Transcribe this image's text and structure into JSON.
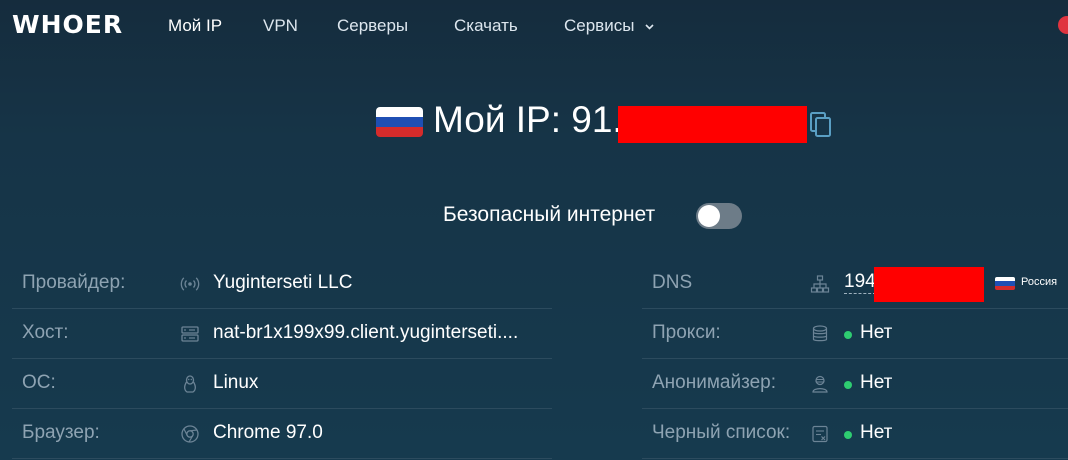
{
  "header": {
    "logo": "WHOER",
    "nav": [
      {
        "label": "Мой IP",
        "active": true
      },
      {
        "label": "VPN",
        "active": false
      },
      {
        "label": "Серверы",
        "active": false
      },
      {
        "label": "Скачать",
        "active": false
      },
      {
        "label": "Сервисы",
        "active": false,
        "has_dropdown": true
      }
    ]
  },
  "ip_section": {
    "country_flag": "russia-flag",
    "title": "Мой IP: 91.",
    "copy_icon": "copy-icon"
  },
  "safe_internet": {
    "label": "Безопасный интернет",
    "enabled": false
  },
  "left_rows": [
    {
      "label": "Провайдер:",
      "icon": "signal-icon",
      "value": "Yuginterseti LLC"
    },
    {
      "label": "Хост:",
      "icon": "server-icon",
      "value": "nat-br1x199x99.client.yuginterseti...."
    },
    {
      "label": "ОС:",
      "icon": "linux-icon",
      "value": "Linux"
    },
    {
      "label": "Браузер:",
      "icon": "chrome-icon",
      "value": "Chrome 97.0"
    }
  ],
  "right_rows": [
    {
      "label": "DNS",
      "icon": "network-icon",
      "value": "194",
      "country": "Россия"
    },
    {
      "label": "Прокси:",
      "icon": "database-icon",
      "value": "Нет",
      "status_color": "#2ecc71"
    },
    {
      "label": "Анонимайзер:",
      "icon": "user-mask-icon",
      "value": "Нет",
      "status_color": "#2ecc71"
    },
    {
      "label": "Черный список:",
      "icon": "blacklist-icon",
      "value": "Нет",
      "status_color": "#2ecc71"
    }
  ],
  "colors": {
    "background": "#163447",
    "label": "#8ea3b2",
    "status_ok": "#2ecc71",
    "redaction": "#ff0000",
    "badge": "#e0343f"
  }
}
